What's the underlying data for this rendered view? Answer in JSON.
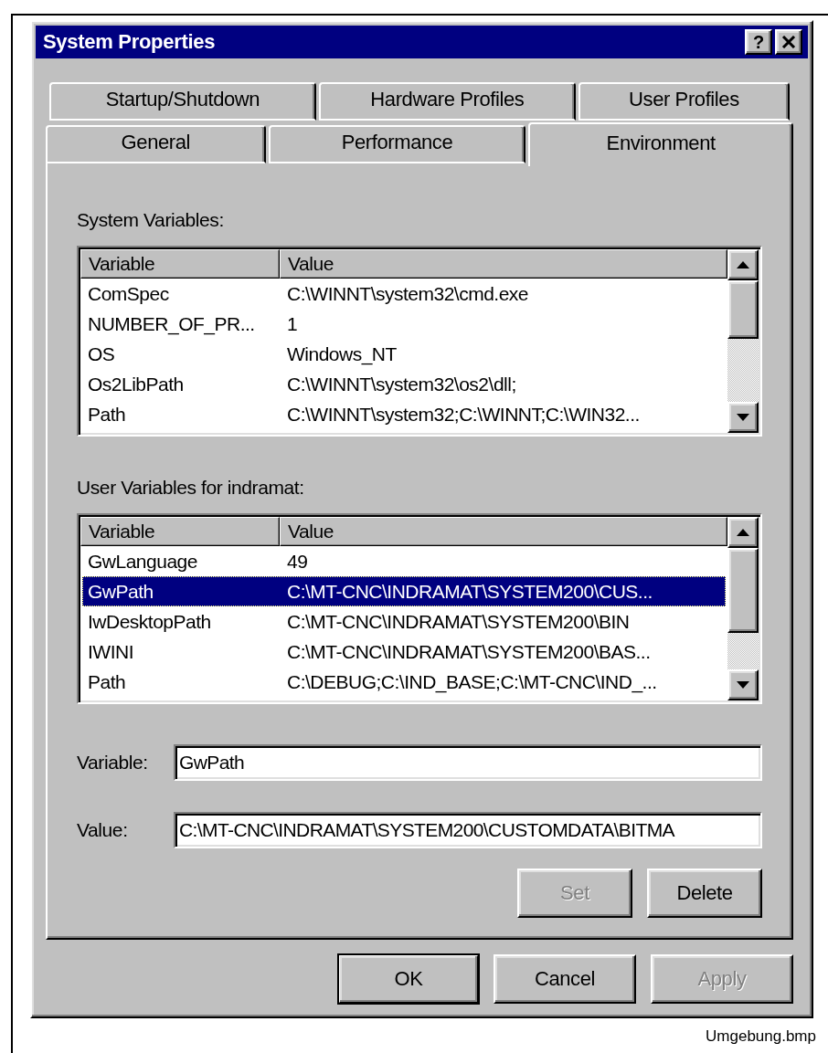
{
  "window": {
    "title": "System Properties",
    "help_button": "?"
  },
  "tab_rows": [
    {
      "tabs": [
        {
          "label": "Startup/Shutdown",
          "selected": false
        },
        {
          "label": "Hardware Profiles",
          "selected": false
        },
        {
          "label": "User Profiles",
          "selected": false
        }
      ]
    },
    {
      "tabs": [
        {
          "label": "General",
          "selected": false
        },
        {
          "label": "Performance",
          "selected": false
        },
        {
          "label": "Environment",
          "selected": true
        }
      ]
    }
  ],
  "system_variables": {
    "label": "System Variables:",
    "columns": [
      "Variable",
      "Value"
    ],
    "rows": [
      {
        "variable": "ComSpec",
        "value": "C:\\WINNT\\system32\\cmd.exe",
        "selected": false
      },
      {
        "variable": "NUMBER_OF_PR...",
        "value": "1",
        "selected": false
      },
      {
        "variable": "OS",
        "value": "Windows_NT",
        "selected": false
      },
      {
        "variable": "Os2LibPath",
        "value": "C:\\WINNT\\system32\\os2\\dll;",
        "selected": false
      },
      {
        "variable": "Path",
        "value": "C:\\WINNT\\system32;C:\\WINNT;C:\\WIN32...",
        "selected": false
      }
    ]
  },
  "user_variables": {
    "label": "User Variables for indramat:",
    "columns": [
      "Variable",
      "Value"
    ],
    "rows": [
      {
        "variable": "GwLanguage",
        "value": "49",
        "selected": false
      },
      {
        "variable": "GwPath",
        "value": "C:\\MT-CNC\\INDRAMAT\\SYSTEM200\\CUS...",
        "selected": true
      },
      {
        "variable": "IwDesktopPath",
        "value": "C:\\MT-CNC\\INDRAMAT\\SYSTEM200\\BIN",
        "selected": false
      },
      {
        "variable": "IWINI",
        "value": "C:\\MT-CNC\\INDRAMAT\\SYSTEM200\\BAS...",
        "selected": false
      },
      {
        "variable": "Path",
        "value": "C:\\DEBUG;C:\\IND_BASE;C:\\MT-CNC\\IND_...",
        "selected": false
      }
    ]
  },
  "fields": [
    {
      "label": "Variable:",
      "value": "GwPath"
    },
    {
      "label": "Value:",
      "value": "C:\\MT-CNC\\INDRAMAT\\SYSTEM200\\CUSTOMDATA\\BITMA"
    }
  ],
  "edit_buttons": [
    {
      "label": "Set",
      "disabled": true
    },
    {
      "label": "Delete",
      "disabled": false
    }
  ],
  "dialog_buttons": [
    {
      "label": "OK",
      "default": true,
      "disabled": false
    },
    {
      "label": "Cancel",
      "default": false,
      "disabled": false
    },
    {
      "label": "Apply",
      "default": false,
      "disabled": true
    }
  ],
  "caption": "Umgebung.bmp"
}
